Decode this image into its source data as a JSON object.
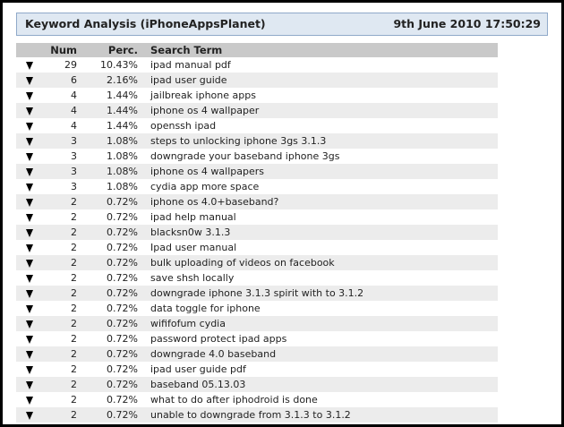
{
  "header": {
    "title": "Keyword Analysis (iPhoneAppsPlanet)",
    "timestamp": "9th June 2010 17:50:29"
  },
  "table": {
    "columns": [
      "",
      "Num",
      "Perc.",
      "Search Term"
    ],
    "rows": [
      {
        "num": "29",
        "perc": "10.43%",
        "term": "ipad manual pdf"
      },
      {
        "num": "6",
        "perc": "2.16%",
        "term": "ipad user guide"
      },
      {
        "num": "4",
        "perc": "1.44%",
        "term": "jailbreak iphone apps"
      },
      {
        "num": "4",
        "perc": "1.44%",
        "term": "iphone os 4 wallpaper"
      },
      {
        "num": "4",
        "perc": "1.44%",
        "term": "openssh ipad"
      },
      {
        "num": "3",
        "perc": "1.08%",
        "term": "steps to unlocking iphone 3gs 3.1.3"
      },
      {
        "num": "3",
        "perc": "1.08%",
        "term": "downgrade your baseband iphone 3gs"
      },
      {
        "num": "3",
        "perc": "1.08%",
        "term": "iphone os 4 wallpapers"
      },
      {
        "num": "3",
        "perc": "1.08%",
        "term": "cydia app more space"
      },
      {
        "num": "2",
        "perc": "0.72%",
        "term": "iphone os 4.0+baseband?"
      },
      {
        "num": "2",
        "perc": "0.72%",
        "term": "ipad help manual"
      },
      {
        "num": "2",
        "perc": "0.72%",
        "term": "blacksn0w 3.1.3"
      },
      {
        "num": "2",
        "perc": "0.72%",
        "term": "Ipad user manual"
      },
      {
        "num": "2",
        "perc": "0.72%",
        "term": "bulk uploading of videos on facebook"
      },
      {
        "num": "2",
        "perc": "0.72%",
        "term": "save shsh locally"
      },
      {
        "num": "2",
        "perc": "0.72%",
        "term": "downgrade iphone 3.1.3 spirit with to 3.1.2"
      },
      {
        "num": "2",
        "perc": "0.72%",
        "term": "data toggle for iphone"
      },
      {
        "num": "2",
        "perc": "0.72%",
        "term": "wififofum cydia"
      },
      {
        "num": "2",
        "perc": "0.72%",
        "term": "password protect ipad apps"
      },
      {
        "num": "2",
        "perc": "0.72%",
        "term": "downgrade 4.0 baseband"
      },
      {
        "num": "2",
        "perc": "0.72%",
        "term": "ipad user guide pdf"
      },
      {
        "num": "2",
        "perc": "0.72%",
        "term": "baseband 05.13.03"
      },
      {
        "num": "2",
        "perc": "0.72%",
        "term": "what to do after iphodroid is done"
      },
      {
        "num": "2",
        "perc": "0.72%",
        "term": "unable to downgrade from 3.1.3 to 3.1.2"
      }
    ]
  }
}
